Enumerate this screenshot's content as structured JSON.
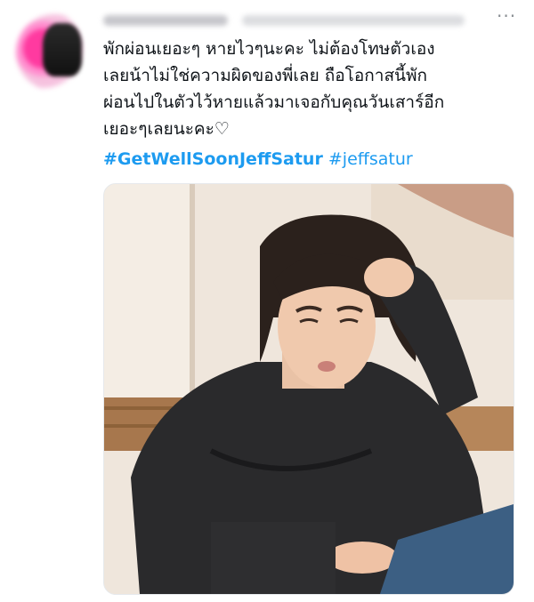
{
  "tweet": {
    "more_icon": "ellipsis-icon",
    "text_lines": [
      "พักผ่อนเยอะๆ หายไวๆนะคะ ไม่ต้องโทษตัวเอง",
      "เลยน้าไม่ใช่ความผิดของพี่เลย ถือโอกาสนี้พัก",
      "ผ่อนไปในตัวไว้หายแล้วมาเจอกับคุณวันเสาร์อีก",
      "เยอะๆเลยนะคะ♡"
    ],
    "hashtags": [
      "#GetWellSoonJeffSatur",
      "#jeffsatur"
    ]
  },
  "colors": {
    "text": "#0f1419",
    "link": "#1d9bf0",
    "muted": "#8a8f94"
  }
}
